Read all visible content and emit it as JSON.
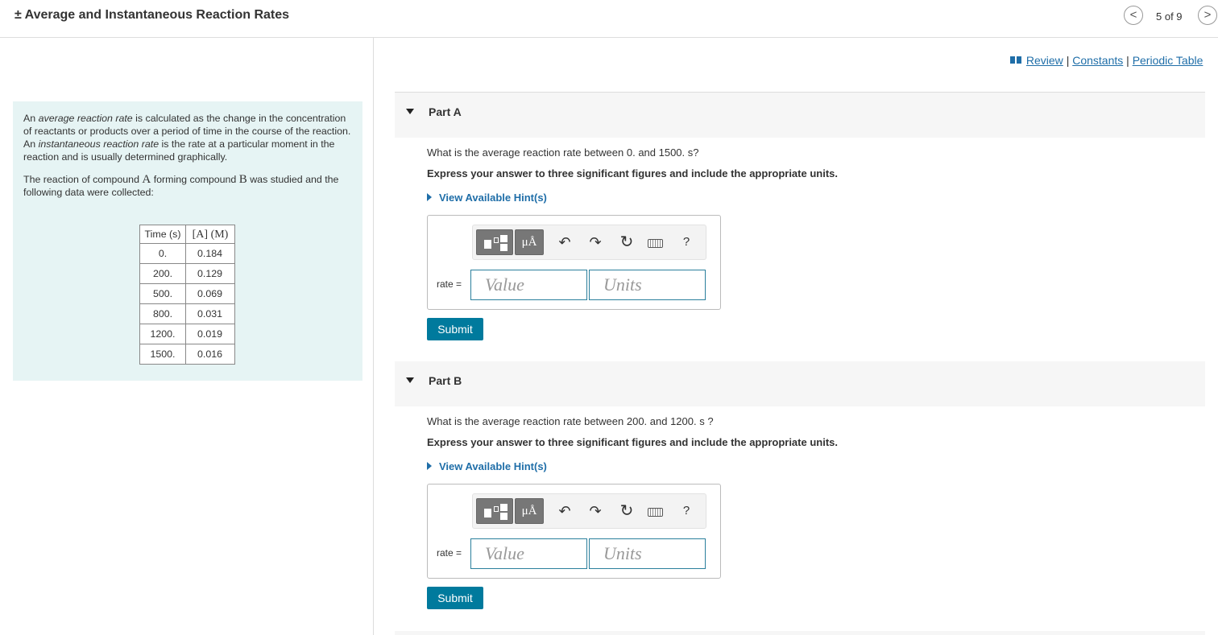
{
  "header": {
    "title": "± Average and Instantaneous Reaction Rates",
    "pager": "5 of 9",
    "prev_label": "<",
    "next_label": ">"
  },
  "links": {
    "review": "Review",
    "separator": "|",
    "constants": "Constants",
    "periodic_table": "Periodic Table"
  },
  "intro": {
    "p1_a": "An ",
    "p1_avg": "average reaction rate",
    "p1_b": " is calculated as the change in the concentration of reactants or products over a period of time in the course of the reaction. An ",
    "p1_inst": "instantaneous reaction rate",
    "p1_c": " is the rate at a particular moment in the reaction and is usually determined graphically.",
    "p2_a": "The reaction of compound ",
    "p2_A": "A",
    "p2_b": " forming compound ",
    "p2_B": "B",
    "p2_c": " was studied and the following data were collected:"
  },
  "table": {
    "header_time": "Time (s)",
    "header_conc": "[A] (M)",
    "rows": [
      {
        "t": "0.",
        "a": "0.184"
      },
      {
        "t": "200.",
        "a": "0.129"
      },
      {
        "t": "500.",
        "a": "0.069"
      },
      {
        "t": "800.",
        "a": "0.031"
      },
      {
        "t": "1200.",
        "a": "0.019"
      },
      {
        "t": "1500.",
        "a": "0.016"
      }
    ]
  },
  "partA": {
    "label": "Part A",
    "question": "What is the average reaction rate between 0. and 1500. s?",
    "express": "Express your answer to three significant figures and include the appropriate units.",
    "hint": "View Available Hint(s)",
    "rate_label": "rate =",
    "value_placeholder": "Value",
    "units_placeholder": "Units",
    "submit": "Submit"
  },
  "partB": {
    "label": "Part B",
    "question": "What is the average reaction rate between 200. and 1200. s ?",
    "express": "Express your answer to three significant figures and include the appropriate units.",
    "hint": "View Available Hint(s)",
    "rate_label": "rate =",
    "value_placeholder": "Value",
    "units_placeholder": "Units",
    "submit": "Submit"
  },
  "toolbar": {
    "units_button": "μÅ",
    "undo": "↶",
    "redo": "↷",
    "reset": "↻",
    "help": "?"
  },
  "icons": [
    "templates-icon",
    "units-icon",
    "undo-icon",
    "redo-icon",
    "reset-icon",
    "keyboard-icon",
    "help-icon",
    "book-icon",
    "chevron-left-icon",
    "chevron-right-icon"
  ]
}
